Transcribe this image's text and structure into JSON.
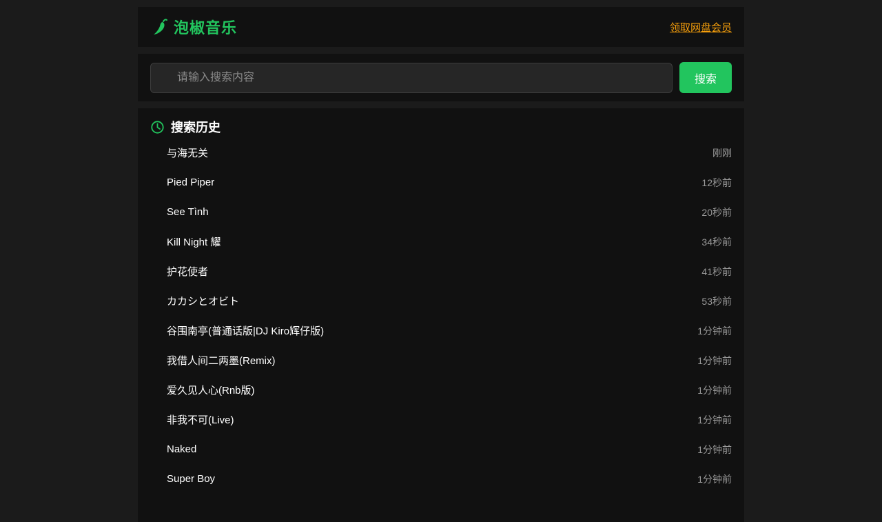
{
  "header": {
    "brand_name": "泡椒音乐",
    "brand_icon": "chili-pepper-icon",
    "vip_link": "领取网盘会员",
    "colors": {
      "brand": "#22c55e",
      "link": "#f59e0b"
    }
  },
  "search": {
    "placeholder": "请输入搜索内容",
    "value": "",
    "button_label": "搜索",
    "button_color": "#22c55e"
  },
  "history": {
    "title": "搜索历史",
    "icon": "clock-icon",
    "items": [
      {
        "title": "与海无关",
        "time": "刚刚"
      },
      {
        "title": "Pied Piper",
        "time": "12秒前"
      },
      {
        "title": "See Tình",
        "time": "20秒前"
      },
      {
        "title": "Kill Night 耀",
        "time": "34秒前"
      },
      {
        "title": "护花使者",
        "time": "41秒前"
      },
      {
        "title": "カカシとオビト",
        "time": "53秒前"
      },
      {
        "title": "谷围南亭(普通话版|DJ Kiro辉仔版)",
        "time": "1分钟前"
      },
      {
        "title": "我借人间二两墨(Remix)",
        "time": "1分钟前"
      },
      {
        "title": "爱久见人心(Rnb版)",
        "time": "1分钟前"
      },
      {
        "title": "非我不可(Live)",
        "time": "1分钟前"
      },
      {
        "title": "Naked",
        "time": "1分钟前"
      },
      {
        "title": "Super Boy",
        "time": "1分钟前"
      }
    ]
  }
}
